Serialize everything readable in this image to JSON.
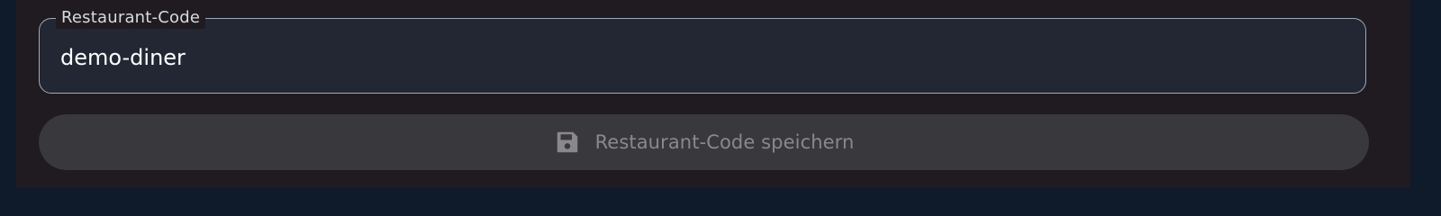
{
  "restaurant_code_field": {
    "label": "Restaurant-Code",
    "value": "demo-diner"
  },
  "save_button": {
    "label": "Restaurant-Code speichern",
    "icon": "save-icon"
  },
  "colors": {
    "background": "#1f1b20",
    "field_fill": "#222733",
    "field_border": "#9ea9bc",
    "button_fill": "#39383c",
    "button_text": "#8a888d"
  }
}
